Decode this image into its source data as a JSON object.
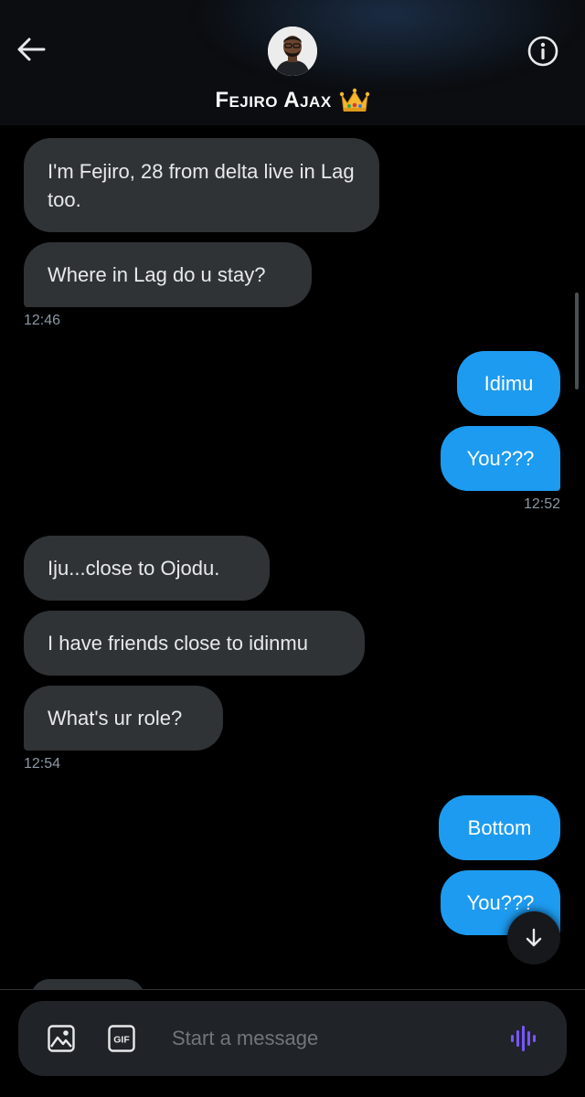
{
  "header": {
    "contact_name": "Fejiro Ajax",
    "crown_emoji": "👑"
  },
  "messages": [
    {
      "id": "m1",
      "direction": "in",
      "text": "I'm Fejiro, 28 from delta live in Lag too."
    },
    {
      "id": "m2",
      "direction": "in",
      "text": "Where in Lag do u stay?",
      "timestamp": "12:46"
    },
    {
      "id": "m3",
      "direction": "out",
      "text": "Idimu"
    },
    {
      "id": "m4",
      "direction": "out",
      "text": "You???",
      "timestamp": "12:52"
    },
    {
      "id": "m5",
      "direction": "in",
      "text": "Iju...close to Ojodu."
    },
    {
      "id": "m6",
      "direction": "in",
      "text": "I have friends close to idinmu"
    },
    {
      "id": "m7",
      "direction": "in",
      "text": "What's ur role?",
      "timestamp": "12:54"
    },
    {
      "id": "m8",
      "direction": "out",
      "text": "Bottom"
    },
    {
      "id": "m9",
      "direction": "out",
      "text": "You???"
    }
  ],
  "composer": {
    "placeholder": "Start a message",
    "gif_label": "GIF"
  },
  "icons": {
    "back": "arrow-left-icon",
    "info": "info-icon",
    "media": "image-icon",
    "gif": "gif-icon",
    "voice": "voice-wave-icon",
    "jump": "arrow-down-icon"
  },
  "colors": {
    "background": "#000000",
    "incoming_bubble": "#2f3336",
    "outgoing_bubble": "#1d9bf0",
    "voice_accent": "#7856ff"
  }
}
